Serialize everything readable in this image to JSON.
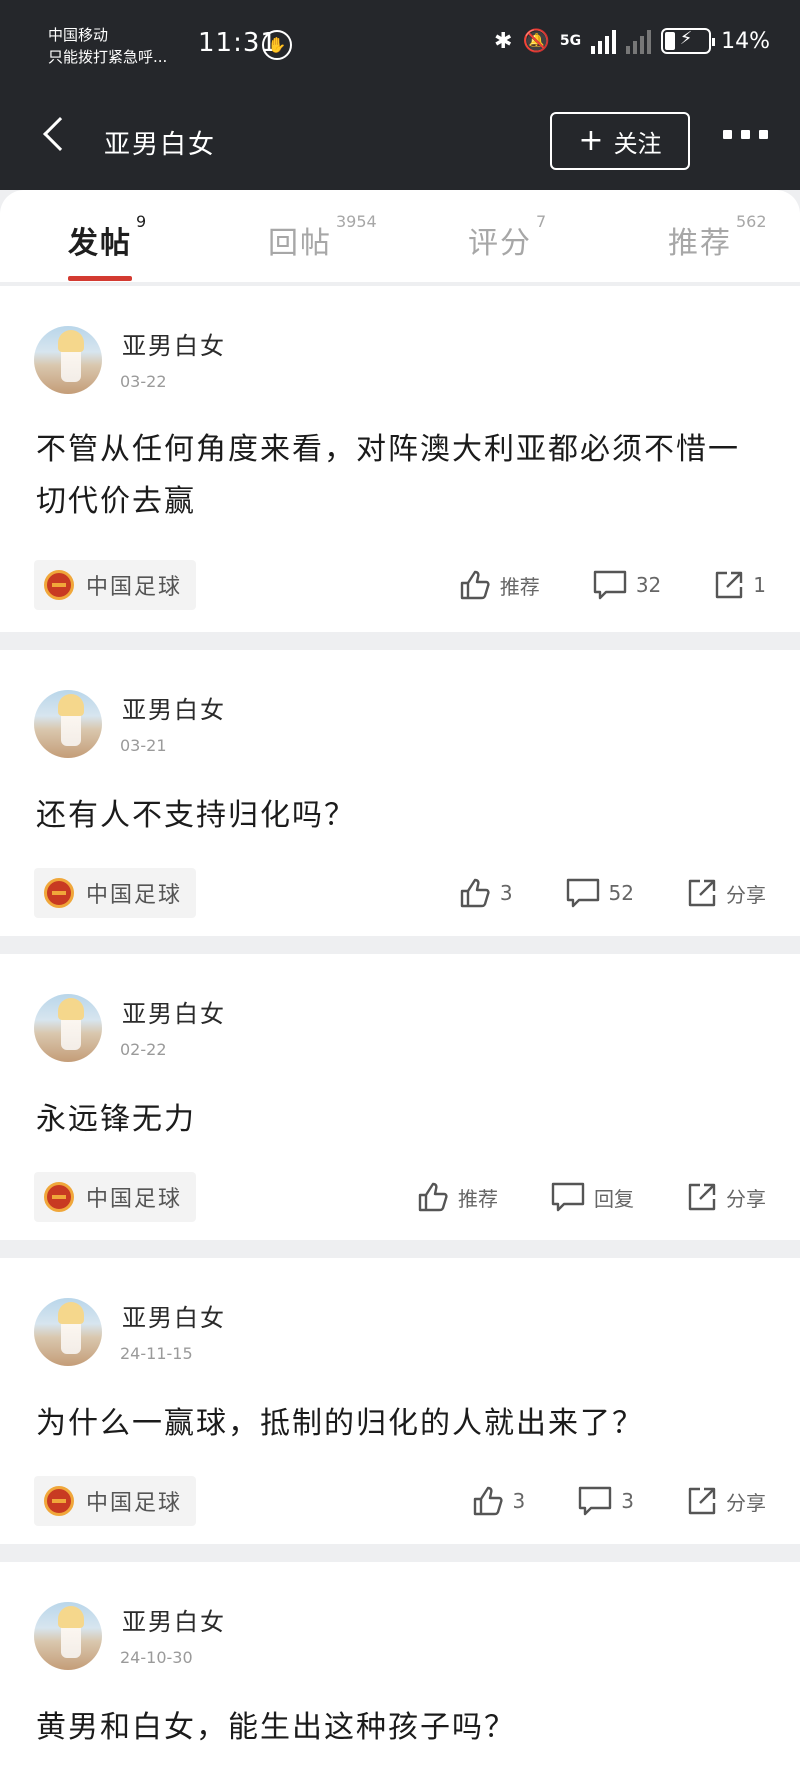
{
  "status_bar": {
    "carrier": "中国移动",
    "carrier_note": "只能拨打紧急呼...",
    "time": "11:31",
    "network": "5G",
    "battery": "14%"
  },
  "nav": {
    "title": "亚男白女",
    "follow_label": "关注"
  },
  "tabs": [
    {
      "label": "发帖",
      "count": "9"
    },
    {
      "label": "回帖",
      "count": "3954"
    },
    {
      "label": "评分",
      "count": "7"
    },
    {
      "label": "推荐",
      "count": "562"
    }
  ],
  "posts": [
    {
      "author": "亚男白女",
      "date": "03-22",
      "content": "不管从任何角度来看，对阵澳大利亚都必须不惜一切代价去赢",
      "tag": "中国足球",
      "like": "推荐",
      "comment": "32",
      "share": "1"
    },
    {
      "author": "亚男白女",
      "date": "03-21",
      "content": "还有人不支持归化吗？",
      "tag": "中国足球",
      "like": "3",
      "comment": "52",
      "share": "分享"
    },
    {
      "author": "亚男白女",
      "date": "02-22",
      "content": "永远锋无力",
      "tag": "中国足球",
      "like": "推荐",
      "comment": "回复",
      "share": "分享"
    },
    {
      "author": "亚男白女",
      "date": "24-11-15",
      "content": "为什么一赢球，抵制的归化的人就出来了？",
      "tag": "中国足球",
      "like": "3",
      "comment": "3",
      "share": "分享"
    },
    {
      "author": "亚男白女",
      "date": "24-10-30",
      "content": "黄男和白女，能生出这种孩子吗？"
    }
  ],
  "icons": {
    "back": "chevron-left-icon",
    "more": "more-dots-icon",
    "like": "thumbs-up-icon",
    "comment": "comment-icon",
    "share": "share-icon",
    "tag": "china-football-logo-icon"
  },
  "colors": {
    "header_bg": "#25272b",
    "accent": "#d33a31",
    "page_bg": "#eeeff1"
  }
}
